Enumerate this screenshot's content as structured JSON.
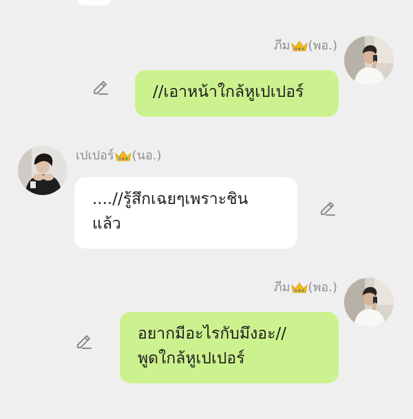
{
  "messages": [
    {
      "side": "right",
      "sender_name": "ภีม",
      "sender_tag": "(พอ.)",
      "text_lines": [
        "//เอาหน้าใกล้หูเปเปอร์"
      ],
      "bubble_color": "#ccf28f",
      "avatar_icon": "avatar-man-white-shirt-icon",
      "edit_icon": "pencil-icon"
    },
    {
      "side": "left",
      "sender_name": "เปเปอร์",
      "sender_tag": "(นอ.)",
      "text_lines": [
        "....//รู้สึกเฉยๆเพราะชิน",
        "แล้ว"
      ],
      "bubble_color": "#ffffff",
      "avatar_icon": "avatar-man-dark-hoodie-icon",
      "edit_icon": "pencil-icon"
    },
    {
      "side": "right",
      "sender_name": "ภีม",
      "sender_tag": "(พอ.)",
      "text_lines": [
        "อยากมีอะไรกับมึงอะ//",
        "พูดใกล้หูเปเปอร์"
      ],
      "bubble_color": "#ccf28f",
      "avatar_icon": "avatar-man-white-shirt-icon",
      "edit_icon": "pencil-icon"
    }
  ],
  "colors": {
    "background": "#efefef",
    "bubble_green": "#ccf28f",
    "bubble_white": "#ffffff",
    "sender_text": "#8d8d8d",
    "crown_gold": "#f2b81f"
  }
}
